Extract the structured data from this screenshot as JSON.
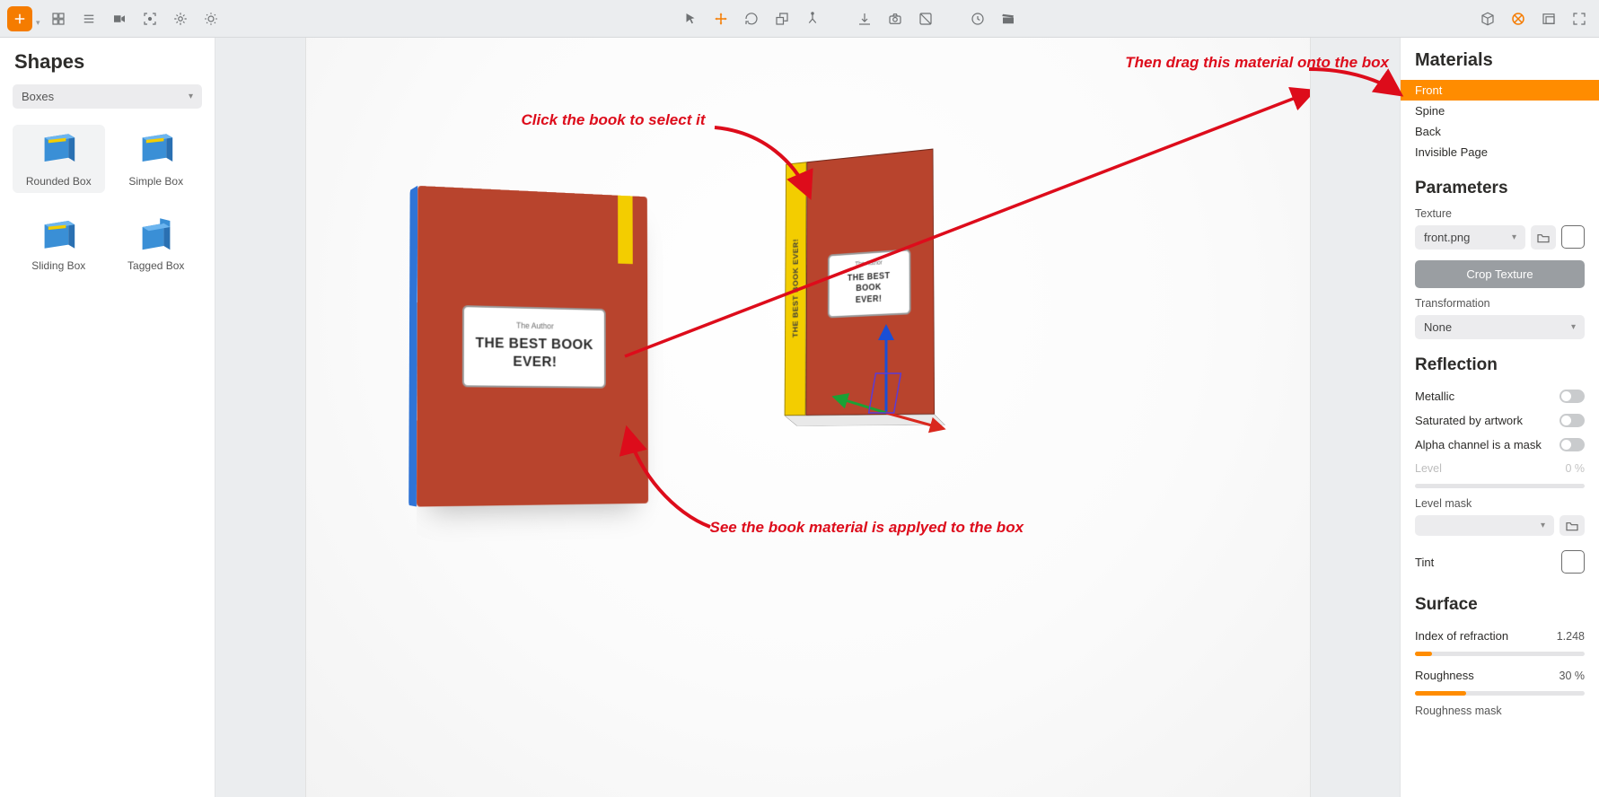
{
  "toolbar": {
    "left_icons": [
      "add",
      "grid",
      "list",
      "camera",
      "focus",
      "gear",
      "sun"
    ],
    "center_icons": [
      "pointer",
      "move",
      "rotate",
      "scale",
      "pivot",
      "align-bottom",
      "camera2",
      "mask",
      "clock",
      "clapper"
    ],
    "right_icons": [
      "cube",
      "target",
      "window",
      "fullscreen"
    ]
  },
  "shapes_panel": {
    "title": "Shapes",
    "category": "Boxes",
    "items": [
      {
        "id": "rounded-box",
        "label": "Rounded Box"
      },
      {
        "id": "simple-box",
        "label": "Simple Box"
      },
      {
        "id": "sliding-box",
        "label": "Sliding Box"
      },
      {
        "id": "tagged-box",
        "label": "Tagged Box"
      }
    ]
  },
  "viewport": {
    "book": {
      "author": "The Author",
      "title_line1": "THE BEST BOOK",
      "title_line2": "EVER!",
      "spine_text": "THE BEST BOOK EVER!"
    },
    "annotations": {
      "a1": "Click the book to select it",
      "a2": "Then drag this material onto the box",
      "a3": "See the book material is applyed to the box"
    }
  },
  "materials_panel": {
    "title": "Materials",
    "list": [
      "Front",
      "Spine",
      "Back",
      "Invisible Page"
    ],
    "active_index": 0,
    "parameters_title": "Parameters",
    "texture_label": "Texture",
    "texture_value": "front.png",
    "crop_button": "Crop Texture",
    "transformation_label": "Transformation",
    "transformation_value": "None",
    "reflection_title": "Reflection",
    "metallic_label": "Metallic",
    "saturated_label": "Saturated by artwork",
    "alpha_label": "Alpha channel is a mask",
    "level_label": "Level",
    "level_value": "0 %",
    "level_mask_label": "Level mask",
    "tint_label": "Tint",
    "surface_title": "Surface",
    "ior_label": "Index of refraction",
    "ior_value": "1.248",
    "ior_fill_pct": 10,
    "roughness_label": "Roughness",
    "roughness_value": "30 %",
    "roughness_fill_pct": 30,
    "roughness_mask_label": "Roughness mask"
  }
}
